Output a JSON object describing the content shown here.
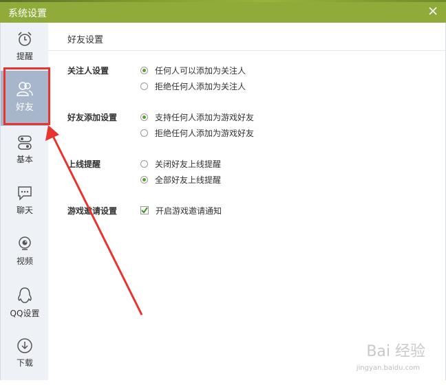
{
  "window": {
    "title": "系统设置"
  },
  "sidebar": {
    "items": [
      {
        "label": "提醒",
        "icon": "alarm-clock-icon"
      },
      {
        "label": "好友",
        "icon": "friends-icon"
      },
      {
        "label": "基本",
        "icon": "toggles-icon"
      },
      {
        "label": "聊天",
        "icon": "chat-bubble-icon"
      },
      {
        "label": "视频",
        "icon": "webcam-icon"
      },
      {
        "label": "QQ设置",
        "icon": "qq-penguin-icon"
      },
      {
        "label": "下载",
        "icon": "download-icon"
      }
    ]
  },
  "main": {
    "section_title": "好友设置",
    "groups": [
      {
        "label": "关注人设置",
        "options": [
          {
            "text": "任何人可以添加为关注人",
            "selected": true
          },
          {
            "text": "拒绝任何人添加为关注人",
            "selected": false
          }
        ]
      },
      {
        "label": "好友添加设置",
        "options": [
          {
            "text": "支持任何人添加为游戏好友",
            "selected": true
          },
          {
            "text": "拒绝任何人添加为游戏好友",
            "selected": false
          }
        ]
      },
      {
        "label": "上线提醒",
        "options": [
          {
            "text": "关闭好友上线提醒",
            "selected": false
          },
          {
            "text": "全部好友上线提醒",
            "selected": true
          }
        ]
      },
      {
        "label": "游戏邀请设置",
        "options": [
          {
            "text": "开启游戏邀请通知",
            "checked": true
          }
        ]
      }
    ]
  },
  "watermark": {
    "logo": "Bai 经验",
    "url": "jingyan.baidu.com"
  },
  "colors": {
    "titlebar": "#8fac3a",
    "active_nav": "#a7b6ca",
    "annotation": "#e8342f",
    "radio_dot": "#5aa02c"
  }
}
